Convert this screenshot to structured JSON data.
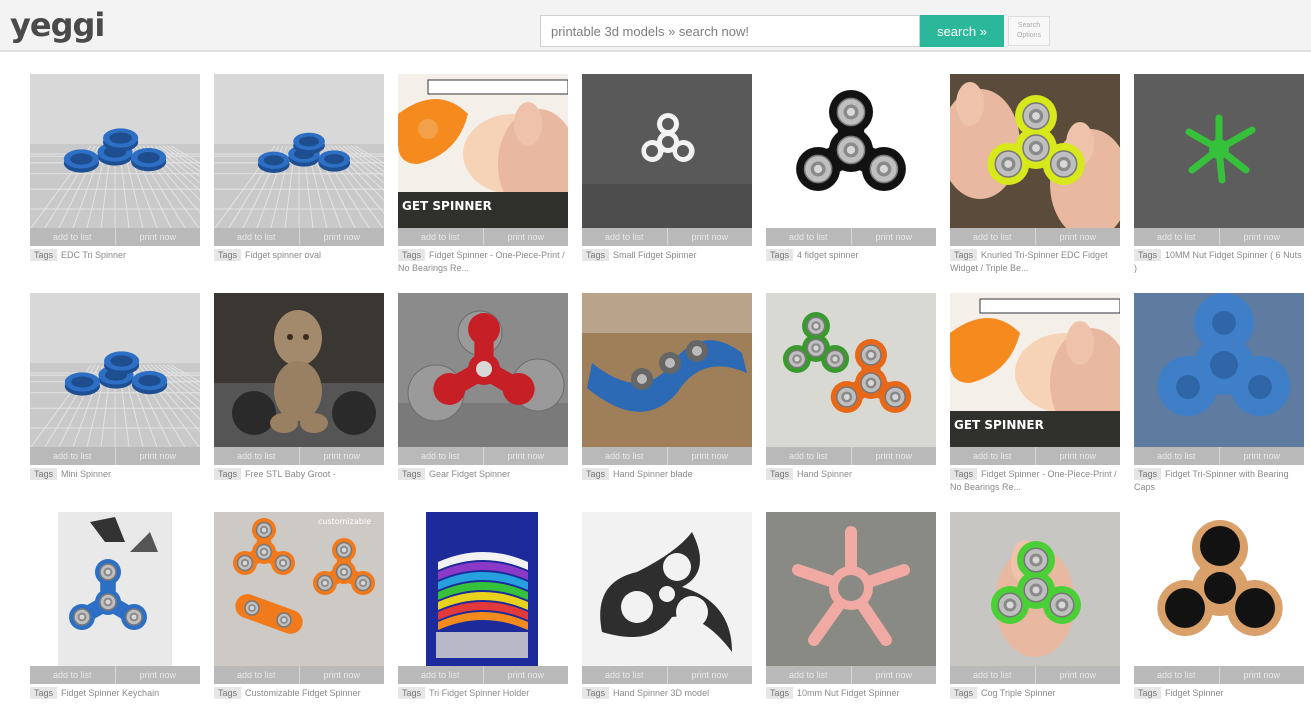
{
  "header": {
    "logo": "yeggi",
    "search_placeholder": "printable 3d models » search now!",
    "search_button": "search »",
    "search_options_line1": "Search",
    "search_options_line2": "Options"
  },
  "card_actions": {
    "add": "add to list",
    "print": "print now"
  },
  "tag_label": "Tags",
  "rows": [
    [
      {
        "title": "EDC Tri Spinner"
      },
      {
        "title": "Fidget spinner oval"
      },
      {
        "title": "Fidget Spinner - One-Piece-Print / No Bearings Re..."
      },
      {
        "title": "Small Fidget Spinner"
      },
      {
        "title": "4 fidget spinner"
      },
      {
        "title": "Knurled Tri-Spinner EDC Fidget Widget / Triple Be..."
      },
      {
        "title": "10MM Nut Fidget Spinner ( 6 Nuts )"
      }
    ],
    [
      {
        "title": "Mini Spinner"
      },
      {
        "title": "Free STL Baby Groot  -"
      },
      {
        "title": "Gear Fidget Spinner"
      },
      {
        "title": "Hand Spinner blade"
      },
      {
        "title": "Hand Spinner"
      },
      {
        "title": "Fidget Spinner - One-Piece-Print / No Bearings Re..."
      },
      {
        "title": "Fidget Tri-Spinner with Bearing Caps"
      }
    ],
    [
      {
        "title": "Fidget Spinner Keychain"
      },
      {
        "title": "Customizable Fidget Spinner"
      },
      {
        "title": "Tri Fidget Spinner Holder"
      },
      {
        "title": "Hand Spinner 3D model"
      },
      {
        "title": "10mm Nut Fidget Spinner"
      },
      {
        "title": "Cog Triple Spinner"
      },
      {
        "title": "Fidget Spinner"
      }
    ]
  ],
  "thumb_texts": {
    "r1c3_banner": "GET SPINNER",
    "r2c6_banner": "GET SPINNER",
    "r3c2_watermark": "customizable"
  },
  "colors": {
    "accent": "#2bb89a",
    "blue_model": "#2d6fc4",
    "orange": "#f28a1e",
    "green": "#35c23a",
    "yellow": "#d7e81c"
  }
}
